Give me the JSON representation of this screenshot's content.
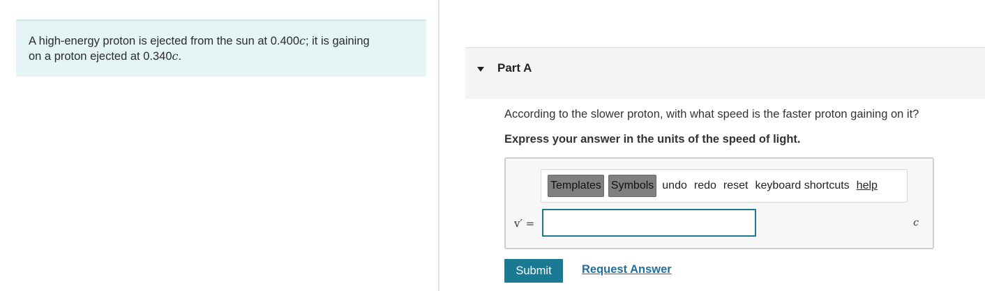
{
  "problem": {
    "line1_prefix": "A high-energy proton is ejected from the sun at 0.400",
    "line1_unit": "c",
    "line1_suffix": "; it is gaining",
    "line2_prefix": "on a proton ejected at 0.340",
    "line2_unit": "c",
    "line2_suffix": "."
  },
  "part": {
    "title": "Part A",
    "question": "According to the slower proton, with what speed is the faster proton gaining on it?",
    "instruction": "Express your answer in the units of the speed of light."
  },
  "toolbar": {
    "templates": "Templates",
    "symbols": "Symbols",
    "undo": "undo",
    "redo": "redo",
    "reset": "reset",
    "shortcuts": "keyboard shortcuts",
    "help": "help"
  },
  "answer": {
    "variable": "v′ =",
    "value": "",
    "unit": "c"
  },
  "actions": {
    "submit": "Submit",
    "request": "Request Answer"
  },
  "colors": {
    "accent": "#1a7993",
    "problem_bg": "#e5f4f5",
    "link": "#1f6f9e"
  }
}
